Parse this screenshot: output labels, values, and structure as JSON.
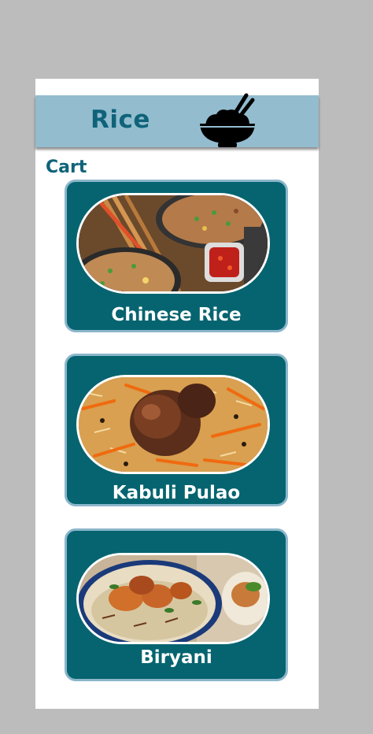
{
  "header": {
    "title": "Rice",
    "icon": "rice-bowl-icon"
  },
  "section": {
    "label": "Cart"
  },
  "items": [
    {
      "title": "Chinese Rice",
      "image": "chinese-fried-rice-photo"
    },
    {
      "title": "Kabuli Pulao",
      "image": "kabuli-pulao-photo"
    },
    {
      "title": "Biryani",
      "image": "biryani-photo"
    }
  ],
  "colors": {
    "background": "#bcbcbc",
    "header_bg": "#93bccf",
    "title_color": "#0f6379",
    "card_bg": "#05646f",
    "card_border": "#8cb6cb"
  }
}
